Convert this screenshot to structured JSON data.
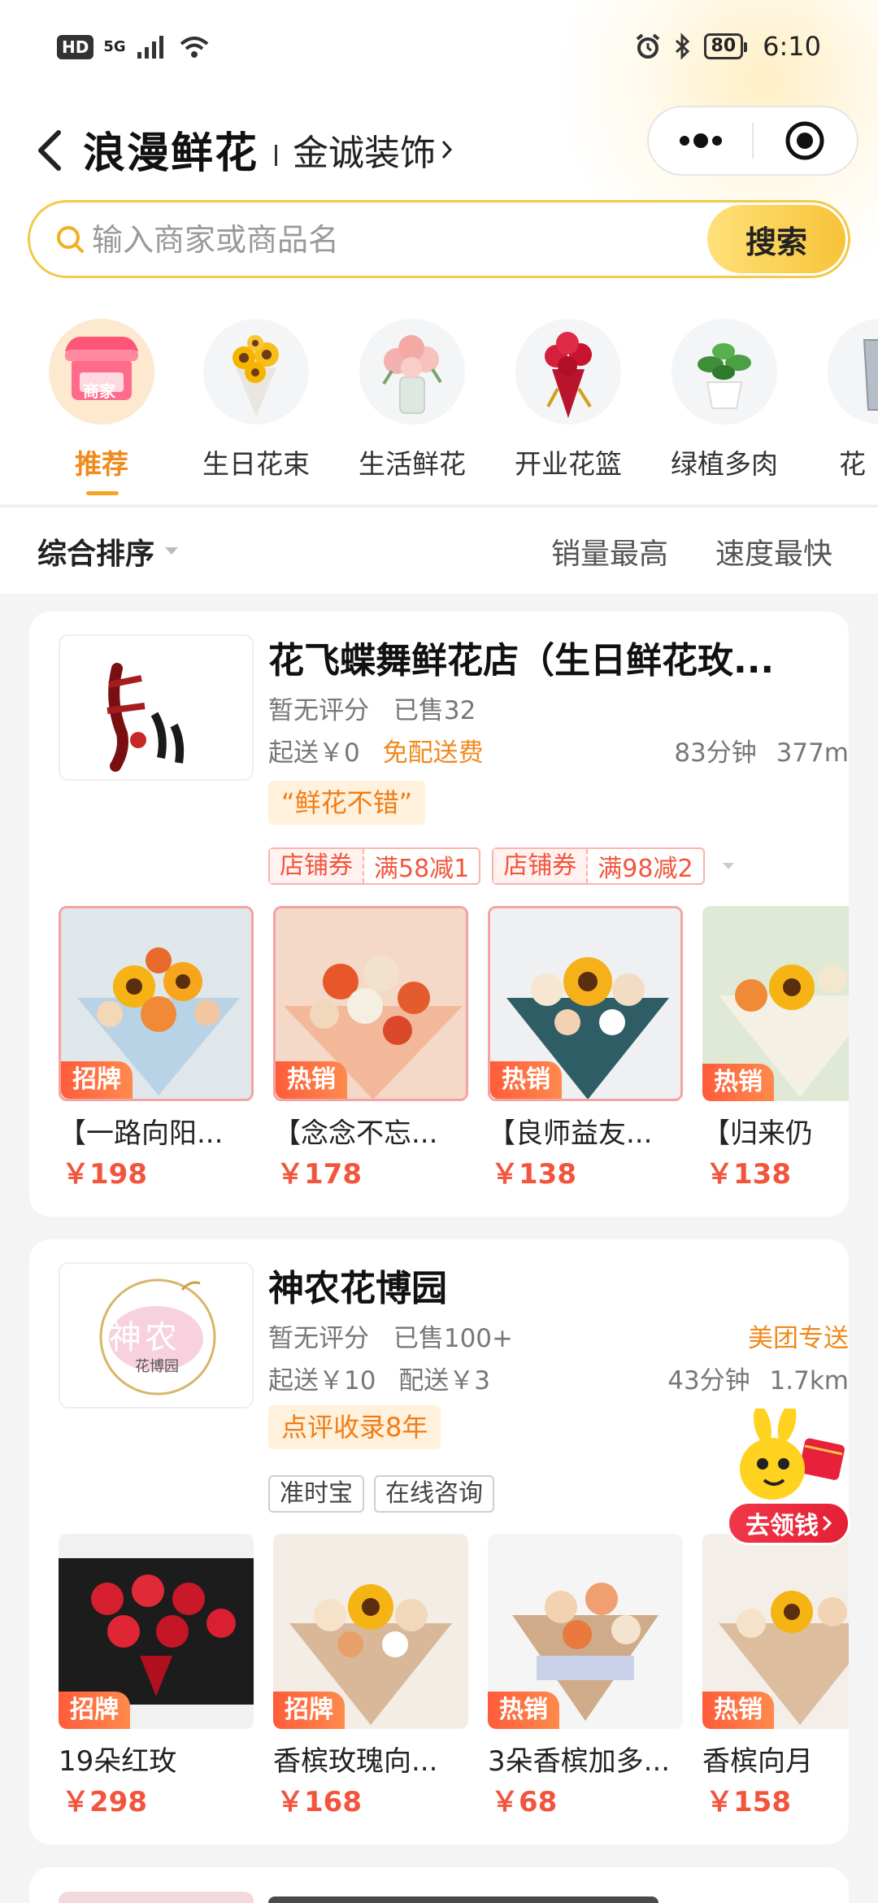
{
  "status_bar": {
    "hd": "HD",
    "net": "5G",
    "battery": "80",
    "time": "6:10"
  },
  "nav": {
    "title": "浪漫鲜花",
    "location": "金诚装饰"
  },
  "search": {
    "placeholder": "输入商家或商品名",
    "button": "搜索"
  },
  "categories": [
    {
      "label": "推荐",
      "badge": "商家",
      "active": true
    },
    {
      "label": "生日花束"
    },
    {
      "label": "生活鲜花"
    },
    {
      "label": "开业花篮"
    },
    {
      "label": "绿植多肉"
    },
    {
      "label": "花"
    }
  ],
  "sort": {
    "comprehensive": "综合排序",
    "sales": "销量最高",
    "speed": "速度最快"
  },
  "stores": [
    {
      "name": "花飞蝶舞鲜花店（生日鲜花玫...",
      "rating": "暂无评分",
      "sold": "已售32",
      "min_order": "起送￥0",
      "delivery": "免配送费",
      "time": "83分钟",
      "distance": "377m",
      "quote": "“鲜花不错”",
      "coupons": [
        {
          "type": "店铺券",
          "value": "满58减1"
        },
        {
          "type": "店铺券",
          "value": "满98减2"
        }
      ],
      "products": [
        {
          "badge": "招牌",
          "name": "【一路向阳...",
          "price": "￥198"
        },
        {
          "badge": "热销",
          "name": "【念念不忘...",
          "price": "￥178"
        },
        {
          "badge": "热销",
          "name": "【良师益友...",
          "price": "￥138"
        },
        {
          "badge": "热销",
          "name": "【归来仍",
          "price": "￥138"
        }
      ]
    },
    {
      "name": "神农花博园",
      "logo_text": "神农",
      "logo_sub": "花博园",
      "rating": "暂无评分",
      "sold": "已售100+",
      "delivery_type": "美团专送",
      "min_order": "起送￥10",
      "delivery_fee": "配送￥3",
      "time": "43分钟",
      "distance": "1.7km",
      "tag": "点评收录8年",
      "services": [
        "准时宝",
        "在线咨询"
      ],
      "products": [
        {
          "badge": "招牌",
          "name": "19朵红玫",
          "price": "￥298"
        },
        {
          "badge": "招牌",
          "name": "香槟玫瑰向...",
          "price": "￥168"
        },
        {
          "badge": "热销",
          "name": "3朵香槟加多...",
          "price": "￥68"
        },
        {
          "badge": "热销",
          "name": "香槟向月",
          "price": "￥158"
        }
      ]
    }
  ],
  "promo": {
    "label": "去领钱"
  },
  "colors": {
    "accent": "#f08a1c",
    "price": "#f2553d",
    "search_border": "#f3c94a"
  }
}
